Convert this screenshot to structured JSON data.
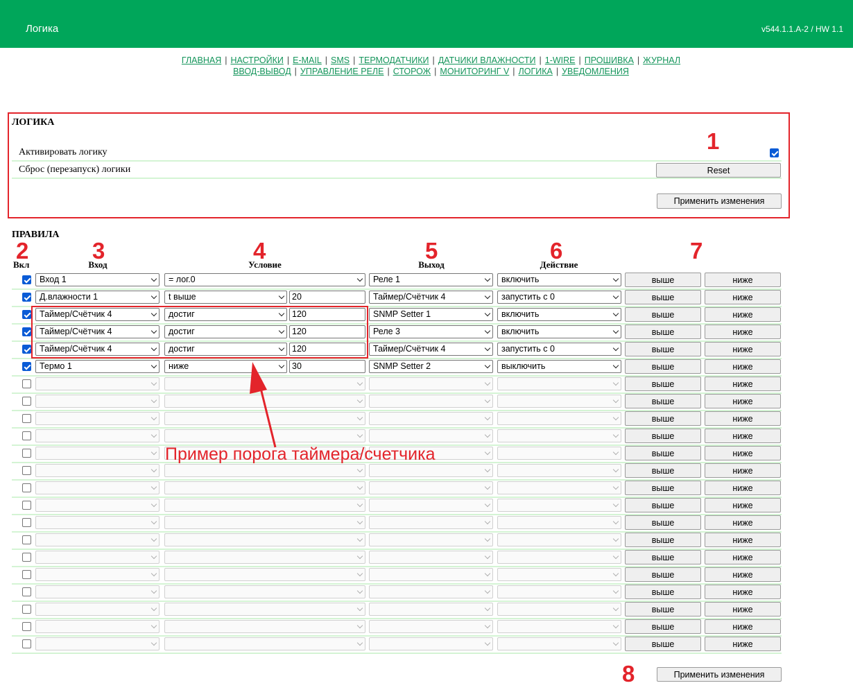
{
  "header": {
    "title": "Логика",
    "version": "v544.1.1.A-2 / HW 1.1"
  },
  "nav": {
    "row1": [
      "ГЛАВНАЯ",
      "НАСТРОЙКИ",
      "E-MAIL",
      "SMS",
      "ТЕРМОДАТЧИКИ",
      "ДАТЧИКИ ВЛАЖНОСТИ",
      "1-WIRE",
      "ПРОШИВКА",
      "ЖУРНАЛ"
    ],
    "row2": [
      "ВВОД-ВЫВОД",
      "УПРАВЛЕНИЕ РЕЛЕ",
      "СТОРОЖ",
      "МОНИТОРИНГ V",
      "ЛОГИКА",
      "УВЕДОМЛЕНИЯ"
    ],
    "separator": "|"
  },
  "logic": {
    "title": "ЛОГИКА",
    "activate_label": "Активировать логику",
    "activate_checked": true,
    "reset_label": "Сброс (перезапуск) логики",
    "reset_button": "Reset",
    "apply_button": "Применить изменения"
  },
  "rules": {
    "title": "ПРАВИЛА",
    "columns": {
      "enabled": "Вкл",
      "input": "Вход",
      "condition": "Условие",
      "output": "Выход",
      "action": "Действие"
    },
    "up_label": "выше",
    "down_label": "ниже",
    "apply_button": "Применить изменения",
    "rows": [
      {
        "enabled": true,
        "input": "Вход 1",
        "condition": "= лог.0",
        "threshold": null,
        "output": "Реле 1",
        "action": "включить"
      },
      {
        "enabled": true,
        "input": "Д.влажности 1",
        "condition": "t выше",
        "threshold": "20",
        "output": "Таймер/Счётчик 4",
        "action": "запустить с 0"
      },
      {
        "enabled": true,
        "input": "Таймер/Счётчик 4",
        "condition": "достиг",
        "threshold": "120",
        "output": "SNMP Setter 1",
        "action": "включить"
      },
      {
        "enabled": true,
        "input": "Таймер/Счётчик 4",
        "condition": "достиг",
        "threshold": "120",
        "output": "Реле 3",
        "action": "включить"
      },
      {
        "enabled": true,
        "input": "Таймер/Счётчик 4",
        "condition": "достиг",
        "threshold": "120",
        "output": "Таймер/Счётчик 4",
        "action": "запустить с 0"
      },
      {
        "enabled": true,
        "input": "Термо 1",
        "condition": "ниже",
        "threshold": "30",
        "output": "SNMP Setter 2",
        "action": "выключить"
      },
      {
        "enabled": false,
        "input": "",
        "condition": "",
        "threshold": null,
        "output": "",
        "action": ""
      },
      {
        "enabled": false,
        "input": "",
        "condition": "",
        "threshold": null,
        "output": "",
        "action": ""
      },
      {
        "enabled": false,
        "input": "",
        "condition": "",
        "threshold": null,
        "output": "",
        "action": ""
      },
      {
        "enabled": false,
        "input": "",
        "condition": "",
        "threshold": null,
        "output": "",
        "action": ""
      },
      {
        "enabled": false,
        "input": "",
        "condition": "",
        "threshold": null,
        "output": "",
        "action": ""
      },
      {
        "enabled": false,
        "input": "",
        "condition": "",
        "threshold": null,
        "output": "",
        "action": ""
      },
      {
        "enabled": false,
        "input": "",
        "condition": "",
        "threshold": null,
        "output": "",
        "action": ""
      },
      {
        "enabled": false,
        "input": "",
        "condition": "",
        "threshold": null,
        "output": "",
        "action": ""
      },
      {
        "enabled": false,
        "input": "",
        "condition": "",
        "threshold": null,
        "output": "",
        "action": ""
      },
      {
        "enabled": false,
        "input": "",
        "condition": "",
        "threshold": null,
        "output": "",
        "action": ""
      },
      {
        "enabled": false,
        "input": "",
        "condition": "",
        "threshold": null,
        "output": "",
        "action": ""
      },
      {
        "enabled": false,
        "input": "",
        "condition": "",
        "threshold": null,
        "output": "",
        "action": ""
      },
      {
        "enabled": false,
        "input": "",
        "condition": "",
        "threshold": null,
        "output": "",
        "action": ""
      },
      {
        "enabled": false,
        "input": "",
        "condition": "",
        "threshold": null,
        "output": "",
        "action": ""
      },
      {
        "enabled": false,
        "input": "",
        "condition": "",
        "threshold": null,
        "output": "",
        "action": ""
      },
      {
        "enabled": false,
        "input": "",
        "condition": "",
        "threshold": null,
        "output": "",
        "action": ""
      }
    ]
  },
  "annotations": {
    "markers": [
      "1",
      "2",
      "3",
      "4",
      "5",
      "6",
      "7",
      "8"
    ],
    "note": "Пример порога таймера/счетчика",
    "color": "#e3242b"
  },
  "colors": {
    "header_bg": "#00a65a",
    "link": "#13945a",
    "row_separator": "#d4f4d4",
    "checkbox": "#0a5bd6"
  }
}
